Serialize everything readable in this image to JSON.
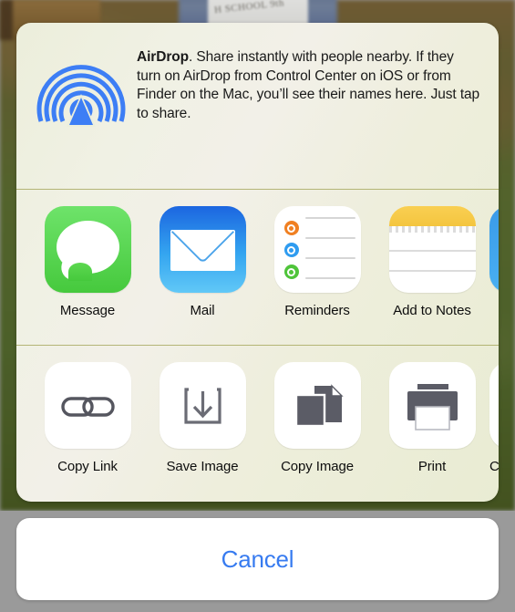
{
  "background": {
    "description": "blurred outdoor photo of a person holding a handwritten sign",
    "sign_text": "H SCHOOL 9th"
  },
  "share_sheet": {
    "airdrop": {
      "icon": "airdrop-icon",
      "title": "AirDrop",
      "body": ". Share instantly with people nearby. If they turn on AirDrop from Control Center on iOS or from Finder on the Mac, you’ll see their names here. Just tap to share.",
      "full_text": "AirDrop. Share instantly with people nearby. If they turn on AirDrop from Control Center on iOS or from Finder on the Mac, you’ll see their names here. Just tap to share.",
      "icon_color": "#3d7ef5"
    },
    "apps": [
      {
        "label": "Message",
        "icon": "messages-app-icon",
        "color": "#46c93d"
      },
      {
        "label": "Mail",
        "icon": "mail-app-icon",
        "color": "#34a5f0"
      },
      {
        "label": "Reminders",
        "icon": "reminders-app-icon",
        "color": "#ffffff"
      },
      {
        "label": "Add to Notes",
        "icon": "notes-app-icon",
        "color": "#f4c53f"
      },
      {
        "label": "",
        "icon": "more-apps-partial-icon",
        "color": "#3a9ae8"
      }
    ],
    "actions": [
      {
        "label": "Copy Link",
        "icon": "link-icon"
      },
      {
        "label": "Save Image",
        "icon": "download-icon"
      },
      {
        "label": "Copy Image",
        "icon": "copy-documents-icon"
      },
      {
        "label": "Print",
        "icon": "printer-icon"
      },
      {
        "label": "C",
        "icon": "partial-action-icon"
      }
    ]
  },
  "cancel": {
    "label": "Cancel",
    "color": "#377bf0"
  }
}
